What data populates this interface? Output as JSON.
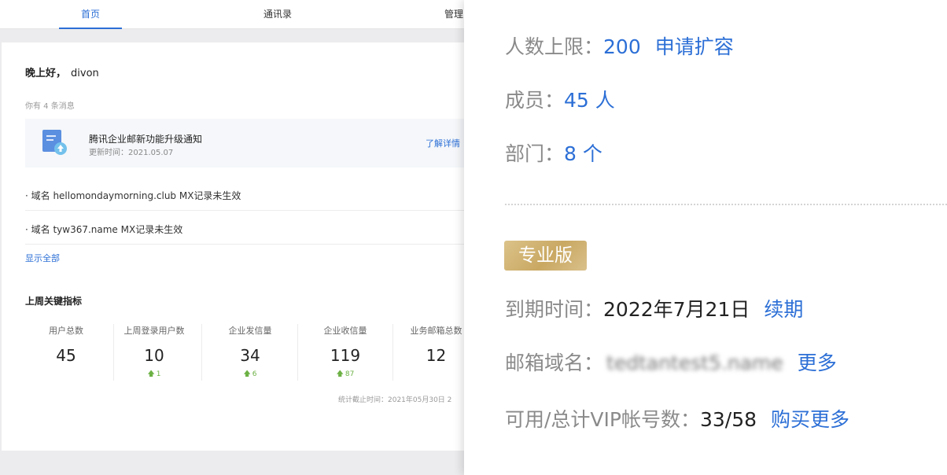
{
  "nav": {
    "tabs": [
      {
        "label": "首页"
      },
      {
        "label": "通讯录"
      },
      {
        "label": "管理"
      }
    ]
  },
  "dashboard": {
    "greeting": "晚上好，",
    "username": "divon",
    "message_count": "你有 4 条消息",
    "notice": {
      "title": "腾讯企业邮新功能升级通知",
      "updated": "更新时间：2021.05.07",
      "link": "了解详情"
    },
    "domain_alerts": [
      {
        "text": "· 域名 hellomondaymorning.club MX记录未生效"
      },
      {
        "text": "· 域名 tyw367.name MX记录未生效"
      }
    ],
    "show_all": "显示全部",
    "metrics_title": "上周关键指标",
    "metrics": [
      {
        "label": "用户总数",
        "value": "45",
        "delta": ""
      },
      {
        "label": "上周登录用户数",
        "value": "10",
        "delta": "1"
      },
      {
        "label": "企业发信量",
        "value": "34",
        "delta": "6"
      },
      {
        "label": "企业收信量",
        "value": "119",
        "delta": "87"
      },
      {
        "label": "业务邮箱总数",
        "value": "12",
        "delta": ""
      }
    ],
    "stats_time": "统计截止时间：2021年05月30日 2"
  },
  "account": {
    "limit_label": "人数上限：",
    "limit_value": "200",
    "limit_link": "申请扩容",
    "members_label": "成员：",
    "members_value": "45 人",
    "depts_label": "部门：",
    "depts_value": "8 个",
    "edition": "专业版",
    "expiry_label": "到期时间：",
    "expiry_value": "2022年7月21日",
    "expiry_link": "续期",
    "domain_label": "邮箱域名：",
    "domain_value": "tedtantest5.name",
    "domain_link": "更多",
    "vip_label": "可用/总计VIP帐号数：",
    "vip_value": "33/58",
    "vip_link": "购买更多"
  },
  "colors": {
    "accent": "#2c6fd6",
    "positive": "#6cb144",
    "gold": "#c9a862"
  }
}
